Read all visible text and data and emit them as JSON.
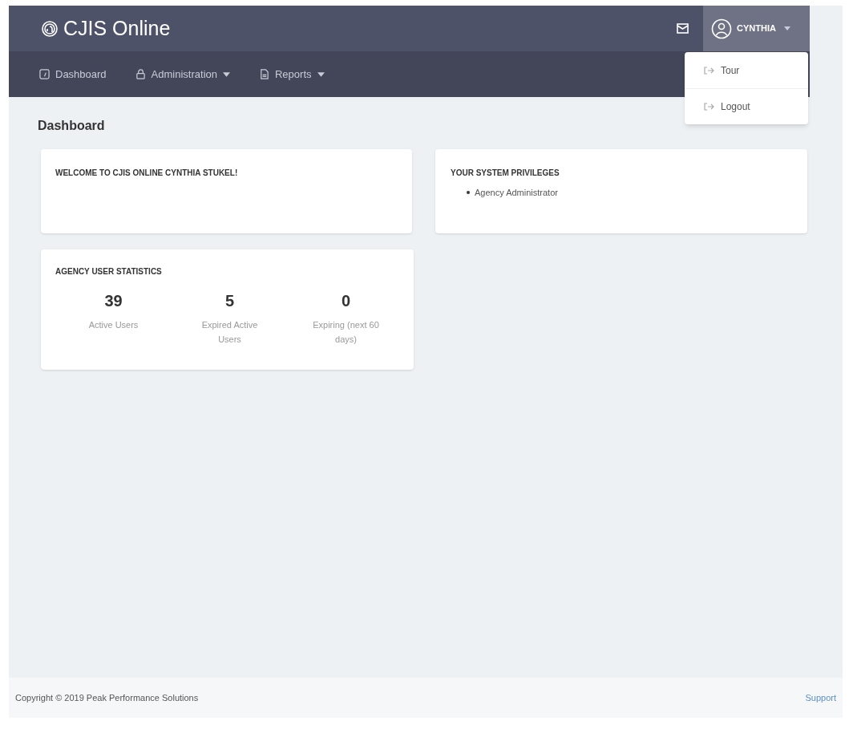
{
  "header": {
    "brand": "CJIS Online",
    "user": "CYNTHIA"
  },
  "nav": [
    {
      "kind": "dashboard",
      "label": "Dashboard",
      "dropdown": false
    },
    {
      "kind": "admin",
      "label": "Administration",
      "dropdown": true
    },
    {
      "kind": "reports",
      "label": "Reports",
      "dropdown": true
    }
  ],
  "user_menu": {
    "expanded": true,
    "items": [
      "Tour",
      "Logout"
    ]
  },
  "page_title": "Dashboard",
  "welcome": {
    "title": "WELCOME TO CJIS ONLINE CYNTHIA STUKEL!"
  },
  "privileges": {
    "title": "YOUR SYSTEM PRIVILEGES",
    "items": [
      "Agency Administrator"
    ]
  },
  "stats": {
    "title": "AGENCY USER STATISTICS",
    "items": [
      {
        "value": "39",
        "label": "Active Users"
      },
      {
        "value": "5",
        "label": "Expired Active Users"
      },
      {
        "value": "0",
        "label": "Expiring (next 60 days)"
      }
    ]
  },
  "footer": {
    "copyright": "Copyright © 2019 Peak Performance Solutions",
    "link": "Support"
  }
}
